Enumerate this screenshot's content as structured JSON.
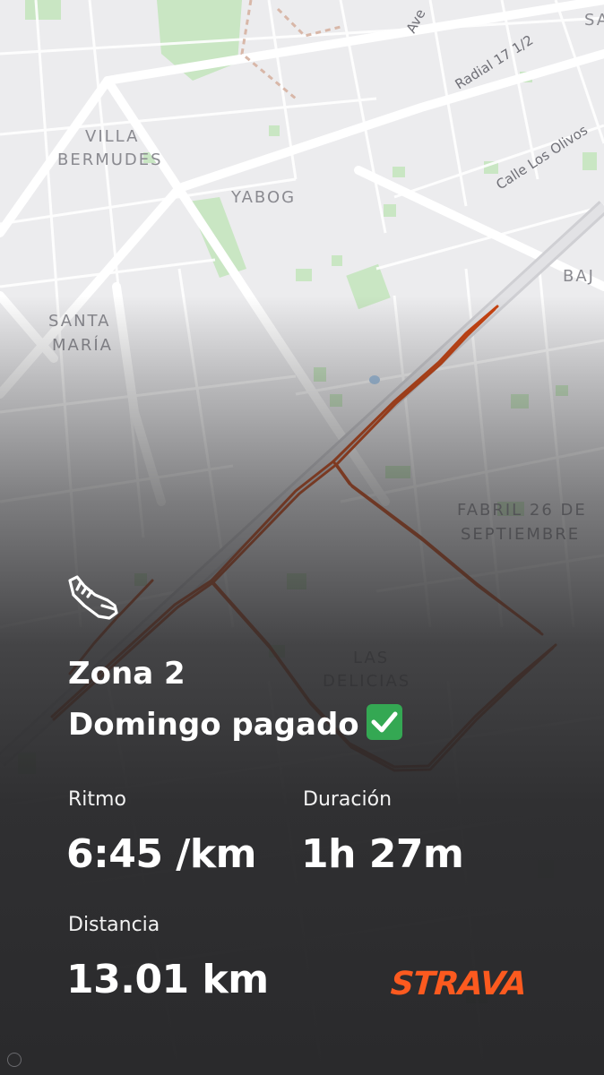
{
  "map": {
    "labels": {
      "villa_1": "VILLA",
      "villa_2": "BERMUDES",
      "yabog": "YABOG",
      "santa_1": "SANTA",
      "santa_2": "MARÍA",
      "fabril_1": "FABRIL 26 DE",
      "fabril_2": "SEPTIEMBRE",
      "delicias_1": "LAS",
      "delicias_2": "DELICIAS",
      "baj": "BAJ",
      "sa": "SA",
      "radial": "Radial 17 1/2",
      "los_olivos": "Calle Los Olivos",
      "ave": "Ave"
    },
    "route_color": "#c9420f"
  },
  "activity": {
    "title_line1": "Zona 2",
    "title_line2": "Domingo pagado",
    "check_emoji": "✅",
    "icon": "running-shoe-icon"
  },
  "stats": {
    "pace_label": "Ritmo",
    "pace_value": "6:45 /km",
    "duration_label": "Duración",
    "duration_value": "1h 27m",
    "distance_label": "Distancia",
    "distance_value": "13.01 km"
  },
  "brand": {
    "name": "STRAVA",
    "color": "#fc5a1f"
  }
}
